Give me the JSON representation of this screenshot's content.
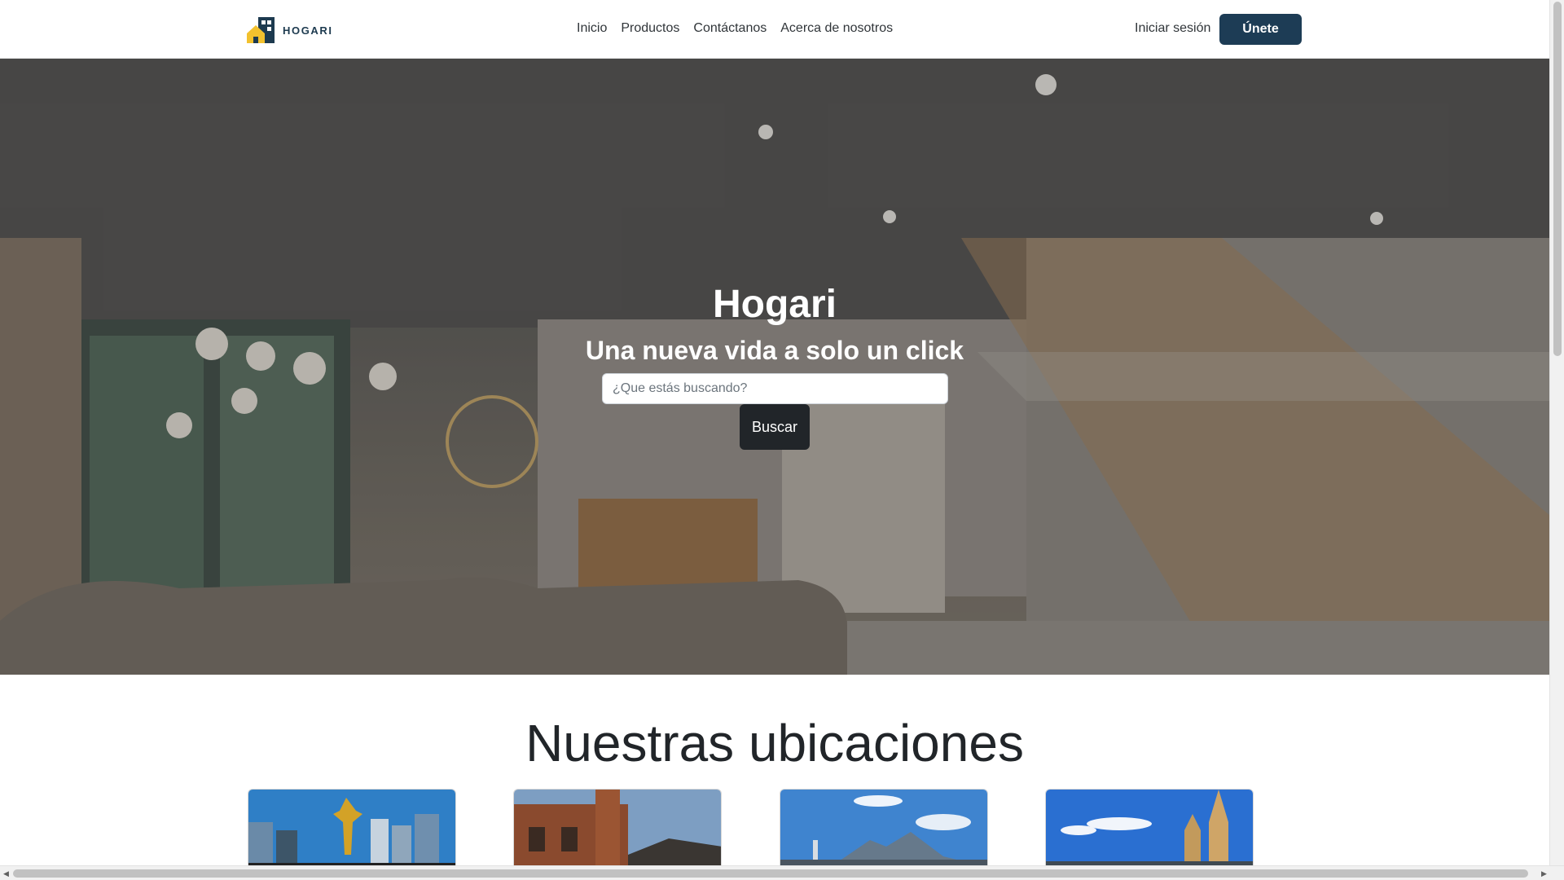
{
  "brand": {
    "name": "HOGARI",
    "logo_icon": "house-building-logo-icon",
    "colors": {
      "house": "#f2c12e",
      "building": "#1d3a4f"
    }
  },
  "nav": {
    "links": [
      {
        "label": "Inicio"
      },
      {
        "label": "Productos"
      },
      {
        "label": "Contáctanos"
      },
      {
        "label": "Acerca de nosotros"
      }
    ],
    "login_label": "Iniciar sesión",
    "join_label": "Únete",
    "join_color": "#1d3c55"
  },
  "hero": {
    "title": "Hogari",
    "subtitle": "Una nueva vida a solo un click",
    "search_placeholder": "¿Que estás buscando?",
    "search_value": "",
    "search_button": "Buscar"
  },
  "locations": {
    "title": "Nuestras ubicaciones",
    "cards": [
      {
        "image": "city-skyline-angel-monument-image"
      },
      {
        "image": "brick-station-building-image"
      },
      {
        "image": "mountain-city-panorama-image"
      },
      {
        "image": "cathedral-towers-image"
      }
    ]
  }
}
